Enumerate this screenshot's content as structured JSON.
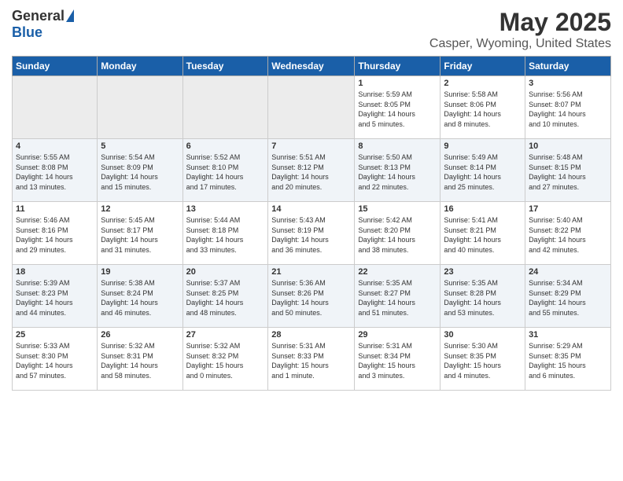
{
  "header": {
    "logo_general": "General",
    "logo_blue": "Blue",
    "main_title": "May 2025",
    "subtitle": "Casper, Wyoming, United States"
  },
  "days_of_week": [
    "Sunday",
    "Monday",
    "Tuesday",
    "Wednesday",
    "Thursday",
    "Friday",
    "Saturday"
  ],
  "weeks": [
    {
      "shaded": false,
      "days": [
        {
          "num": "",
          "empty": true,
          "info": ""
        },
        {
          "num": "",
          "empty": true,
          "info": ""
        },
        {
          "num": "",
          "empty": true,
          "info": ""
        },
        {
          "num": "",
          "empty": true,
          "info": ""
        },
        {
          "num": "1",
          "empty": false,
          "info": "Sunrise: 5:59 AM\nSunset: 8:05 PM\nDaylight: 14 hours\nand 5 minutes."
        },
        {
          "num": "2",
          "empty": false,
          "info": "Sunrise: 5:58 AM\nSunset: 8:06 PM\nDaylight: 14 hours\nand 8 minutes."
        },
        {
          "num": "3",
          "empty": false,
          "info": "Sunrise: 5:56 AM\nSunset: 8:07 PM\nDaylight: 14 hours\nand 10 minutes."
        }
      ]
    },
    {
      "shaded": true,
      "days": [
        {
          "num": "4",
          "empty": false,
          "info": "Sunrise: 5:55 AM\nSunset: 8:08 PM\nDaylight: 14 hours\nand 13 minutes."
        },
        {
          "num": "5",
          "empty": false,
          "info": "Sunrise: 5:54 AM\nSunset: 8:09 PM\nDaylight: 14 hours\nand 15 minutes."
        },
        {
          "num": "6",
          "empty": false,
          "info": "Sunrise: 5:52 AM\nSunset: 8:10 PM\nDaylight: 14 hours\nand 17 minutes."
        },
        {
          "num": "7",
          "empty": false,
          "info": "Sunrise: 5:51 AM\nSunset: 8:12 PM\nDaylight: 14 hours\nand 20 minutes."
        },
        {
          "num": "8",
          "empty": false,
          "info": "Sunrise: 5:50 AM\nSunset: 8:13 PM\nDaylight: 14 hours\nand 22 minutes."
        },
        {
          "num": "9",
          "empty": false,
          "info": "Sunrise: 5:49 AM\nSunset: 8:14 PM\nDaylight: 14 hours\nand 25 minutes."
        },
        {
          "num": "10",
          "empty": false,
          "info": "Sunrise: 5:48 AM\nSunset: 8:15 PM\nDaylight: 14 hours\nand 27 minutes."
        }
      ]
    },
    {
      "shaded": false,
      "days": [
        {
          "num": "11",
          "empty": false,
          "info": "Sunrise: 5:46 AM\nSunset: 8:16 PM\nDaylight: 14 hours\nand 29 minutes."
        },
        {
          "num": "12",
          "empty": false,
          "info": "Sunrise: 5:45 AM\nSunset: 8:17 PM\nDaylight: 14 hours\nand 31 minutes."
        },
        {
          "num": "13",
          "empty": false,
          "info": "Sunrise: 5:44 AM\nSunset: 8:18 PM\nDaylight: 14 hours\nand 33 minutes."
        },
        {
          "num": "14",
          "empty": false,
          "info": "Sunrise: 5:43 AM\nSunset: 8:19 PM\nDaylight: 14 hours\nand 36 minutes."
        },
        {
          "num": "15",
          "empty": false,
          "info": "Sunrise: 5:42 AM\nSunset: 8:20 PM\nDaylight: 14 hours\nand 38 minutes."
        },
        {
          "num": "16",
          "empty": false,
          "info": "Sunrise: 5:41 AM\nSunset: 8:21 PM\nDaylight: 14 hours\nand 40 minutes."
        },
        {
          "num": "17",
          "empty": false,
          "info": "Sunrise: 5:40 AM\nSunset: 8:22 PM\nDaylight: 14 hours\nand 42 minutes."
        }
      ]
    },
    {
      "shaded": true,
      "days": [
        {
          "num": "18",
          "empty": false,
          "info": "Sunrise: 5:39 AM\nSunset: 8:23 PM\nDaylight: 14 hours\nand 44 minutes."
        },
        {
          "num": "19",
          "empty": false,
          "info": "Sunrise: 5:38 AM\nSunset: 8:24 PM\nDaylight: 14 hours\nand 46 minutes."
        },
        {
          "num": "20",
          "empty": false,
          "info": "Sunrise: 5:37 AM\nSunset: 8:25 PM\nDaylight: 14 hours\nand 48 minutes."
        },
        {
          "num": "21",
          "empty": false,
          "info": "Sunrise: 5:36 AM\nSunset: 8:26 PM\nDaylight: 14 hours\nand 50 minutes."
        },
        {
          "num": "22",
          "empty": false,
          "info": "Sunrise: 5:35 AM\nSunset: 8:27 PM\nDaylight: 14 hours\nand 51 minutes."
        },
        {
          "num": "23",
          "empty": false,
          "info": "Sunrise: 5:35 AM\nSunset: 8:28 PM\nDaylight: 14 hours\nand 53 minutes."
        },
        {
          "num": "24",
          "empty": false,
          "info": "Sunrise: 5:34 AM\nSunset: 8:29 PM\nDaylight: 14 hours\nand 55 minutes."
        }
      ]
    },
    {
      "shaded": false,
      "days": [
        {
          "num": "25",
          "empty": false,
          "info": "Sunrise: 5:33 AM\nSunset: 8:30 PM\nDaylight: 14 hours\nand 57 minutes."
        },
        {
          "num": "26",
          "empty": false,
          "info": "Sunrise: 5:32 AM\nSunset: 8:31 PM\nDaylight: 14 hours\nand 58 minutes."
        },
        {
          "num": "27",
          "empty": false,
          "info": "Sunrise: 5:32 AM\nSunset: 8:32 PM\nDaylight: 15 hours\nand 0 minutes."
        },
        {
          "num": "28",
          "empty": false,
          "info": "Sunrise: 5:31 AM\nSunset: 8:33 PM\nDaylight: 15 hours\nand 1 minute."
        },
        {
          "num": "29",
          "empty": false,
          "info": "Sunrise: 5:31 AM\nSunset: 8:34 PM\nDaylight: 15 hours\nand 3 minutes."
        },
        {
          "num": "30",
          "empty": false,
          "info": "Sunrise: 5:30 AM\nSunset: 8:35 PM\nDaylight: 15 hours\nand 4 minutes."
        },
        {
          "num": "31",
          "empty": false,
          "info": "Sunrise: 5:29 AM\nSunset: 8:35 PM\nDaylight: 15 hours\nand 6 minutes."
        }
      ]
    }
  ]
}
